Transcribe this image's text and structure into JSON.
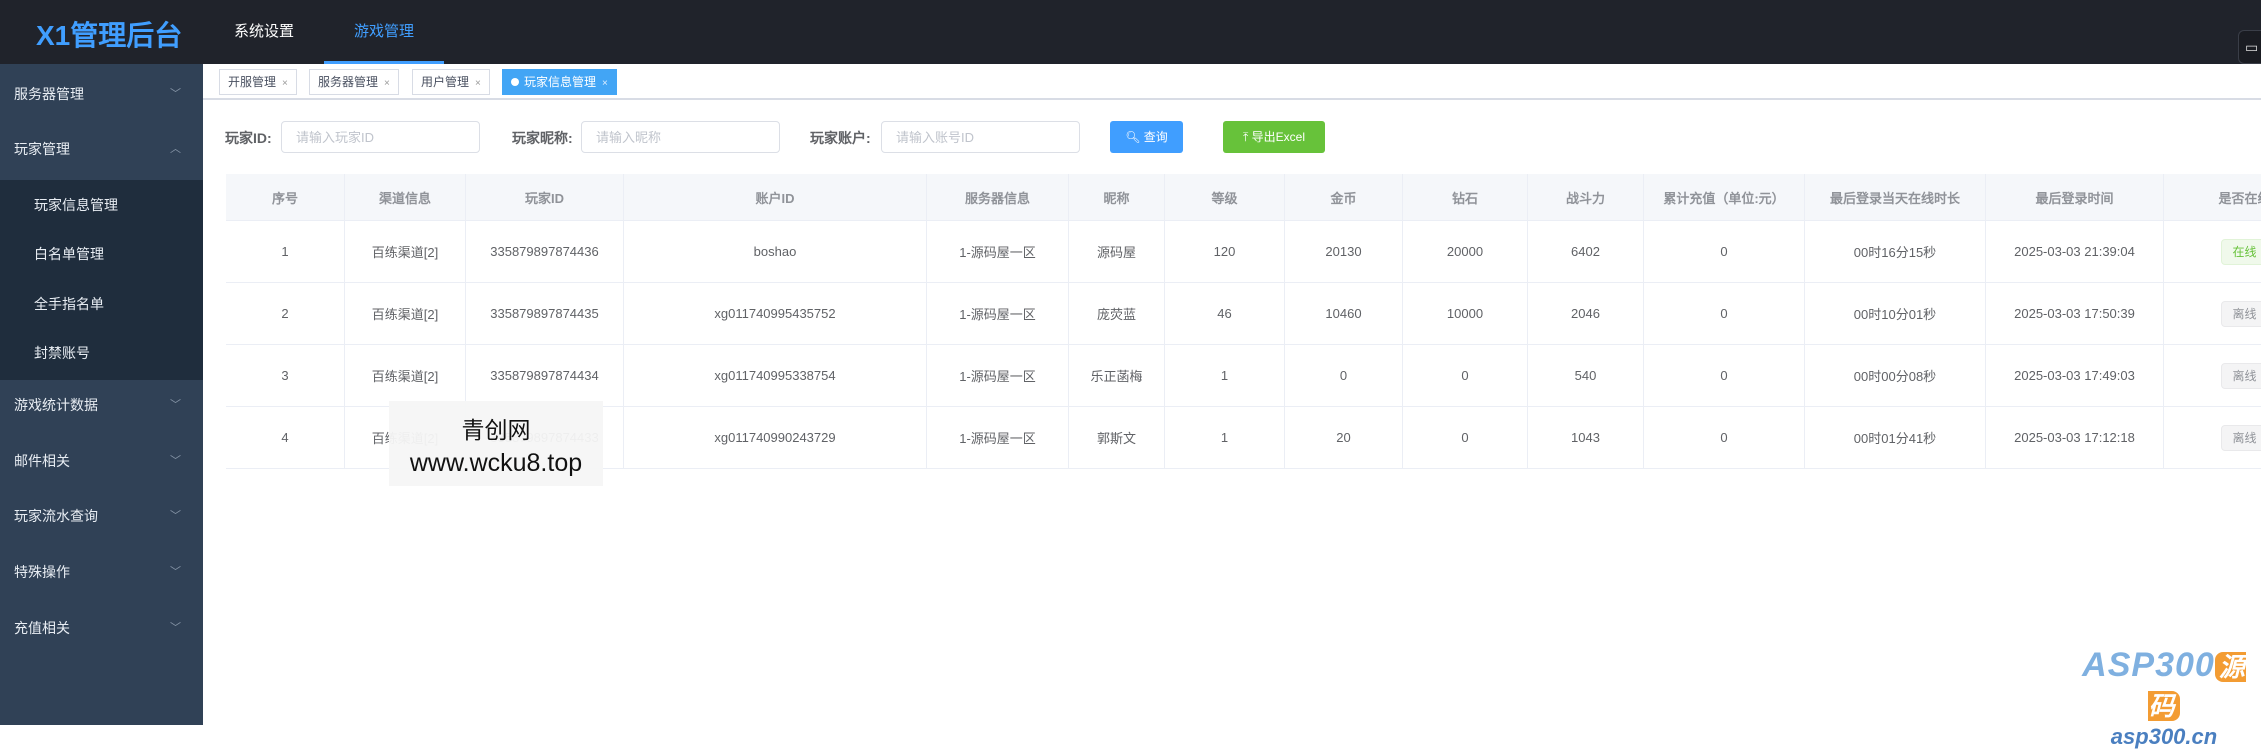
{
  "header": {
    "logo": "X1管理后台",
    "nav": [
      {
        "label": "系统设置",
        "active": false
      },
      {
        "label": "游戏管理",
        "active": true
      }
    ],
    "right_icon": "monitor-icon"
  },
  "sidebar": {
    "items": [
      {
        "label": "服务器管理",
        "expanded": false
      },
      {
        "label": "玩家管理",
        "expanded": true
      },
      {
        "label": "游戏统计数据",
        "expanded": false
      },
      {
        "label": "邮件相关",
        "expanded": false
      },
      {
        "label": "玩家流水查询",
        "expanded": false
      },
      {
        "label": "特殊操作",
        "expanded": false
      },
      {
        "label": "充值相关",
        "expanded": false
      }
    ],
    "sub_items": [
      "玩家信息管理",
      "白名单管理",
      "全手指名单",
      "封禁账号"
    ]
  },
  "tabs": [
    {
      "label": "开服管理",
      "active": false
    },
    {
      "label": "服务器管理",
      "active": false
    },
    {
      "label": "用户管理",
      "active": false
    },
    {
      "label": "玩家信息管理",
      "active": true
    }
  ],
  "search": {
    "player_id": {
      "label": "玩家ID:",
      "placeholder": "请输入玩家ID",
      "value": ""
    },
    "nickname": {
      "label": "玩家昵称:",
      "placeholder": "请输入昵称",
      "value": ""
    },
    "account": {
      "label": "玩家账户:",
      "placeholder": "请输入账号ID",
      "value": ""
    },
    "query_label": "查询",
    "export_label": "导出Excel"
  },
  "table": {
    "columns": [
      "序号",
      "渠道信息",
      "玩家ID",
      "账户ID",
      "服务器信息",
      "昵称",
      "等级",
      "金币",
      "钻石",
      "战斗力",
      "累计充值（单位:元）",
      "最后登录当天在线时长",
      "最后登录时间",
      "是否在线"
    ],
    "rows": [
      [
        "1",
        "百练渠道[2]",
        "335879897874436",
        "boshao",
        "1-源码屋一区",
        "源码屋",
        "120",
        "20130",
        "20000",
        "6402",
        "0",
        "00时16分15秒",
        "2025-03-03 21:39:04",
        "在线"
      ],
      [
        "2",
        "百练渠道[2]",
        "335879897874435",
        "xg011740995435752",
        "1-源码屋一区",
        "庞荧蓝",
        "46",
        "10460",
        "10000",
        "2046",
        "0",
        "00时10分01秒",
        "2025-03-03 17:50:39",
        "离线"
      ],
      [
        "3",
        "百练渠道[2]",
        "335879897874434",
        "xg011740995338754",
        "1-源码屋一区",
        "乐正菡梅",
        "1",
        "0",
        "0",
        "540",
        "0",
        "00时00分08秒",
        "2025-03-03 17:49:03",
        "离线"
      ],
      [
        "4",
        "百练渠道[2]",
        "335879897874433",
        "xg011740990243729",
        "1-源码屋一区",
        "郭斯文",
        "1",
        "20",
        "0",
        "1043",
        "0",
        "00时01分41秒",
        "2025-03-03 17:12:18",
        "离线"
      ]
    ]
  },
  "watermark": {
    "line1": "青创网",
    "line2": "www.wcku8.top"
  },
  "corner_logo": {
    "text": "ASP300源码",
    "url_text": "asp300.cn"
  },
  "colors": {
    "primary": "#409eff",
    "success": "#67c23a",
    "header_bg": "#20232b",
    "sidebar_bg": "#304156"
  }
}
